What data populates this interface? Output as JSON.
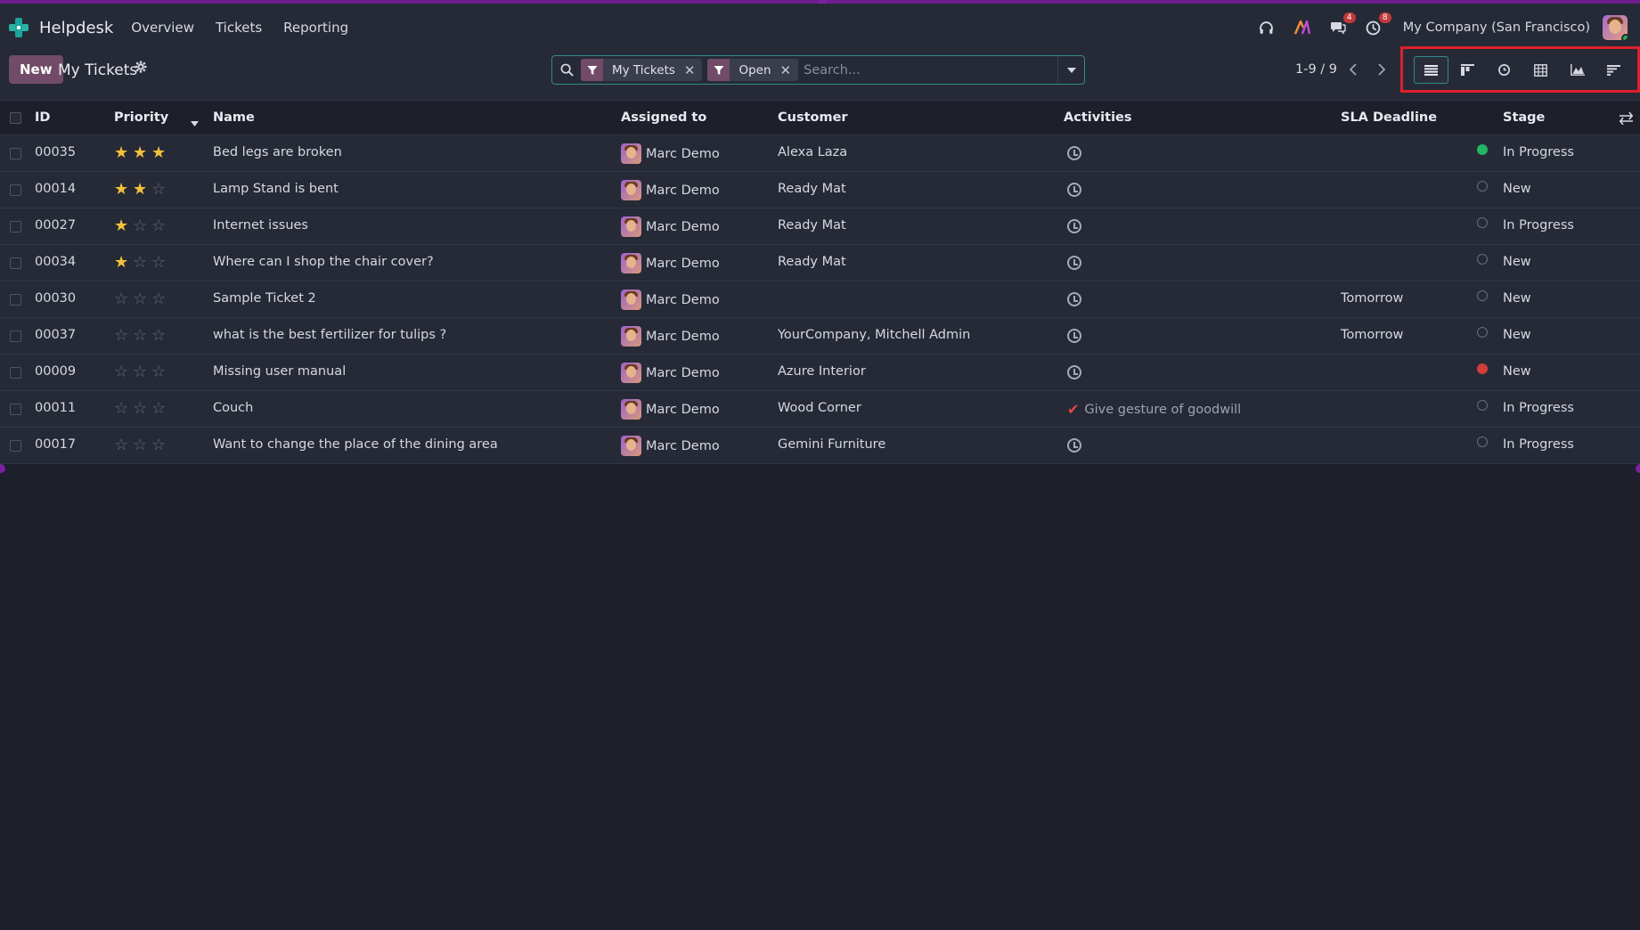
{
  "navbar": {
    "app_name": "Helpdesk",
    "menus": [
      "Overview",
      "Tickets",
      "Reporting"
    ],
    "messages_badge": "4",
    "activities_badge": "8",
    "company": "My Company (San Francisco)"
  },
  "control_panel": {
    "new_label": "New",
    "title": "My Tickets",
    "search": {
      "facets": [
        "My Tickets",
        "Open"
      ],
      "placeholder": "Search..."
    },
    "pager": "1-9 / 9"
  },
  "table": {
    "columns": [
      "ID",
      "Priority",
      "Name",
      "Assigned to",
      "Customer",
      "Activities",
      "SLA Deadline",
      "Stage"
    ],
    "rows": [
      {
        "id": "00035",
        "priority": 3,
        "name": "Bed legs are broken",
        "assigned": "Marc Demo",
        "customer": "Alexa Laza",
        "activity": "",
        "sla": "",
        "kanban": "green",
        "stage": "In Progress"
      },
      {
        "id": "00014",
        "priority": 2,
        "name": "Lamp Stand is bent",
        "assigned": "Marc Demo",
        "customer": "Ready Mat",
        "activity": "",
        "sla": "",
        "kanban": "normal",
        "stage": "New"
      },
      {
        "id": "00027",
        "priority": 1,
        "name": "Internet issues",
        "assigned": "Marc Demo",
        "customer": "Ready Mat",
        "activity": "",
        "sla": "",
        "kanban": "normal",
        "stage": "In Progress"
      },
      {
        "id": "00034",
        "priority": 1,
        "name": "Where can I shop the chair cover?",
        "assigned": "Marc Demo",
        "customer": "Ready Mat",
        "activity": "",
        "sla": "",
        "kanban": "normal",
        "stage": "New"
      },
      {
        "id": "00030",
        "priority": 0,
        "name": "Sample Ticket 2",
        "assigned": "Marc Demo",
        "customer": "",
        "activity": "",
        "sla": "Tomorrow",
        "kanban": "normal",
        "stage": "New"
      },
      {
        "id": "00037",
        "priority": 0,
        "name": "what is the best fertilizer for tulips ?",
        "assigned": "Marc Demo",
        "customer": "YourCompany, Mitchell Admin",
        "activity": "",
        "sla": "Tomorrow",
        "kanban": "normal",
        "stage": "New"
      },
      {
        "id": "00009",
        "priority": 0,
        "name": "Missing user manual",
        "assigned": "Marc Demo",
        "customer": "Azure Interior",
        "activity": "",
        "sla": "",
        "kanban": "red",
        "stage": "New"
      },
      {
        "id": "00011",
        "priority": 0,
        "name": "Couch",
        "assigned": "Marc Demo",
        "customer": "Wood Corner",
        "activity": "Give gesture of goodwill",
        "sla": "",
        "kanban": "normal",
        "stage": "In Progress"
      },
      {
        "id": "00017",
        "priority": 0,
        "name": "Want to change the place of the dining area",
        "assigned": "Marc Demo",
        "customer": "Gemini Furniture",
        "activity": "",
        "sla": "",
        "kanban": "normal",
        "stage": "In Progress"
      }
    ]
  },
  "colors": {
    "accent": "#714b67",
    "teal": "#2e8c8c",
    "star_on": "#f3c13a",
    "highlight_box": "#e0202c"
  }
}
